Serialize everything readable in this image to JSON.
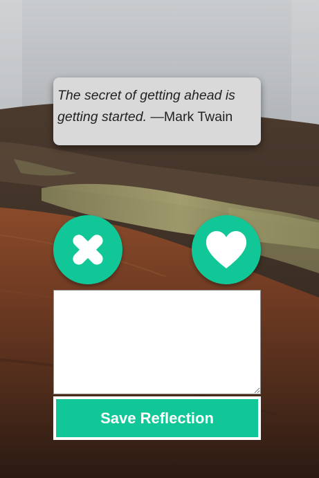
{
  "quote": {
    "text": "The secret of getting ahead is getting started.",
    "author": " —Mark Twain"
  },
  "buttons": {
    "dislike_icon": "close-x-icon",
    "like_icon": "heart-icon",
    "save_label": "Save Reflection"
  },
  "reflection": {
    "value": "",
    "placeholder": ""
  },
  "colors": {
    "accent": "#12c797",
    "card": "#d9d9d9"
  }
}
